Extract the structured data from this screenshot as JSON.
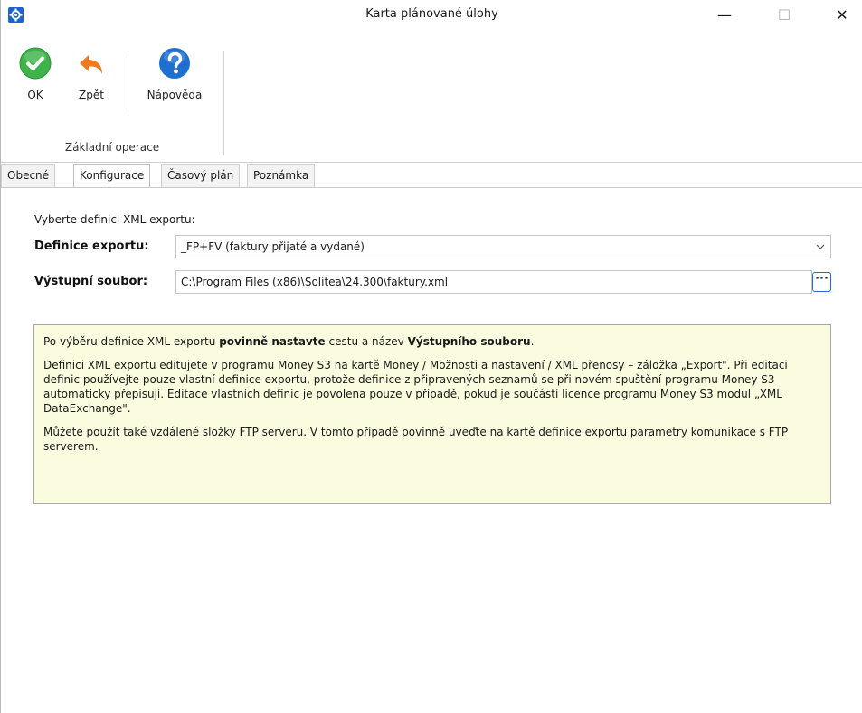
{
  "window": {
    "title": "Karta plánované úlohy",
    "minimize": "—",
    "maximize": "☐",
    "close": "✕"
  },
  "ribbon": {
    "ok_label": "OK",
    "back_label": "Zpět",
    "help_label": "Nápověda",
    "group_label": "Základní operace"
  },
  "tabs": [
    {
      "label": "Obecné",
      "active": false
    },
    {
      "label": "Konfigurace",
      "active": true
    },
    {
      "label": "Časový plán",
      "active": false
    },
    {
      "label": "Poznámka",
      "active": false
    }
  ],
  "config": {
    "prompt": "Vyberte definici XML exportu:",
    "definition_label": "Definice exportu:",
    "definition_value": "_FP+FV (faktury přijaté a vydané)",
    "output_label": "Výstupní soubor:",
    "output_value": "C:\\Program Files (x86)\\Solitea\\24.300\\faktury.xml",
    "browse_label": "···"
  },
  "info": {
    "p1_a": "Po výběru definice XML exportu ",
    "p1_b": "povinně nastavte",
    "p1_c": " cestu a název ",
    "p1_d": "Výstupního souboru",
    "p1_e": ".",
    "p2": "Definici XML exportu editujete v programu Money S3 na kartě Money / Možnosti a nastavení / XML přenosy – záložka „Export\". Při editaci definic používejte pouze vlastní definice exportu, protože definice z připravených seznamů se při novém spuštění programu Money S3 automaticky přepisují. Editace vlastních definic je povolena pouze v případě, pokud je součástí licence programu Money S3 modul „XML DataExchange\".",
    "p3": "Můžete použít také vzdálené složky FTP serveru. V tomto případě povinně uveďte na kartě definice exportu parametry komunikace s FTP serverem."
  },
  "colors": {
    "ok_green": "#3db34a",
    "back_orange": "#f07a22",
    "help_blue": "#1f6fd0",
    "info_bg": "#fbfbdf"
  }
}
